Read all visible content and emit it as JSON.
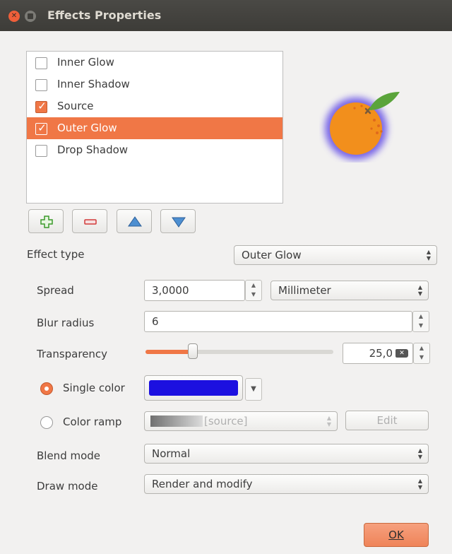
{
  "window": {
    "title": "Effects Properties"
  },
  "effects_list": [
    {
      "label": "Inner Glow",
      "checked": false,
      "selected": false
    },
    {
      "label": "Inner Shadow",
      "checked": false,
      "selected": false
    },
    {
      "label": "Source",
      "checked": true,
      "selected": false
    },
    {
      "label": "Outer Glow",
      "checked": true,
      "selected": true
    },
    {
      "label": "Drop Shadow",
      "checked": false,
      "selected": false
    }
  ],
  "effect_type": {
    "label": "Effect type",
    "value": "Outer Glow"
  },
  "spread": {
    "label": "Spread",
    "value": "3,0000",
    "unit": "Millimeter"
  },
  "blur_radius": {
    "label": "Blur radius",
    "value": "6"
  },
  "transparency": {
    "label": "Transparency",
    "value": "25,0",
    "level": 0.25
  },
  "single_color": {
    "label": "Single color",
    "selected": true,
    "color": "#1c10e0"
  },
  "color_ramp": {
    "label": "Color ramp",
    "selected": false,
    "value": "[source]",
    "edit_label": "Edit"
  },
  "blend_mode": {
    "label": "Blend mode",
    "value": "Normal"
  },
  "draw_mode": {
    "label": "Draw mode",
    "value": "Render and modify"
  },
  "buttons": {
    "ok": "OK"
  },
  "colors": {
    "accent": "#f07746",
    "glow": "#6a55e6",
    "orange": "#f28f1c",
    "leaf": "#5aa43a"
  }
}
